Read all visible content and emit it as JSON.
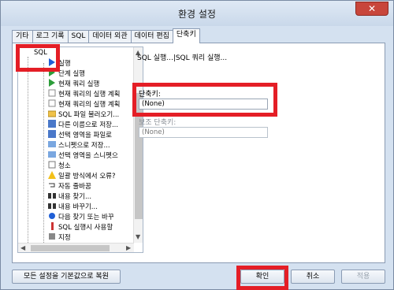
{
  "window": {
    "title": "환경 설정",
    "close_glyph": "✕"
  },
  "tabs": [
    "기타",
    "로그 기록",
    "SQL",
    "데이터 외관",
    "데이터 편집",
    "단축키"
  ],
  "tree": {
    "root": "SQL",
    "selected": "실행",
    "items": [
      {
        "label": "단계 실행",
        "icon": "step-icon"
      },
      {
        "label": "현재 쿼리 실행",
        "icon": "run-query-icon"
      },
      {
        "label": "현재 쿼리의 실행 계획",
        "icon": "plan-icon"
      },
      {
        "label": "현재 쿼리의 실행 계획",
        "icon": "plan-icon"
      },
      {
        "label": "SQL 파일 불러오기...",
        "icon": "open-file-icon"
      },
      {
        "label": "다른 이름으로 저장...",
        "icon": "save-as-icon"
      },
      {
        "label": "선택 영역을 파일로",
        "icon": "save-selection-icon"
      },
      {
        "label": "스니펫으로 저장...",
        "icon": "snippet-icon"
      },
      {
        "label": "선택 영역을 스니펫으",
        "icon": "snippet-icon"
      },
      {
        "label": "청소",
        "icon": "clear-icon"
      },
      {
        "label": "일괄 방식에서 오류?",
        "icon": "warning-icon"
      },
      {
        "label": "자동 줄바꿈",
        "icon": "wrap-icon"
      },
      {
        "label": "내용 찾기...",
        "icon": "find-icon"
      },
      {
        "label": "내용 바꾸기...",
        "icon": "replace-icon"
      },
      {
        "label": "다음 찾기 또는 바꾸",
        "icon": "find-next-icon"
      },
      {
        "label": "SQL 실행시 사용할",
        "icon": "info-icon"
      },
      {
        "label": "지정",
        "icon": "assign-icon"
      }
    ]
  },
  "details": {
    "path": "SQL 실행...|SQL 쿼리 실행...",
    "shortcut_label": "단축키:",
    "shortcut_value": "(None)",
    "secondary_label": "보조 단축키:",
    "secondary_value": "(None)"
  },
  "buttons": {
    "reset": "모든 설정을 기본값으로 복원",
    "ok": "확인",
    "cancel": "취소",
    "apply": "적용"
  },
  "colors": {
    "highlight": "#e41e26",
    "selection_arrow": "#1f5fd6"
  }
}
